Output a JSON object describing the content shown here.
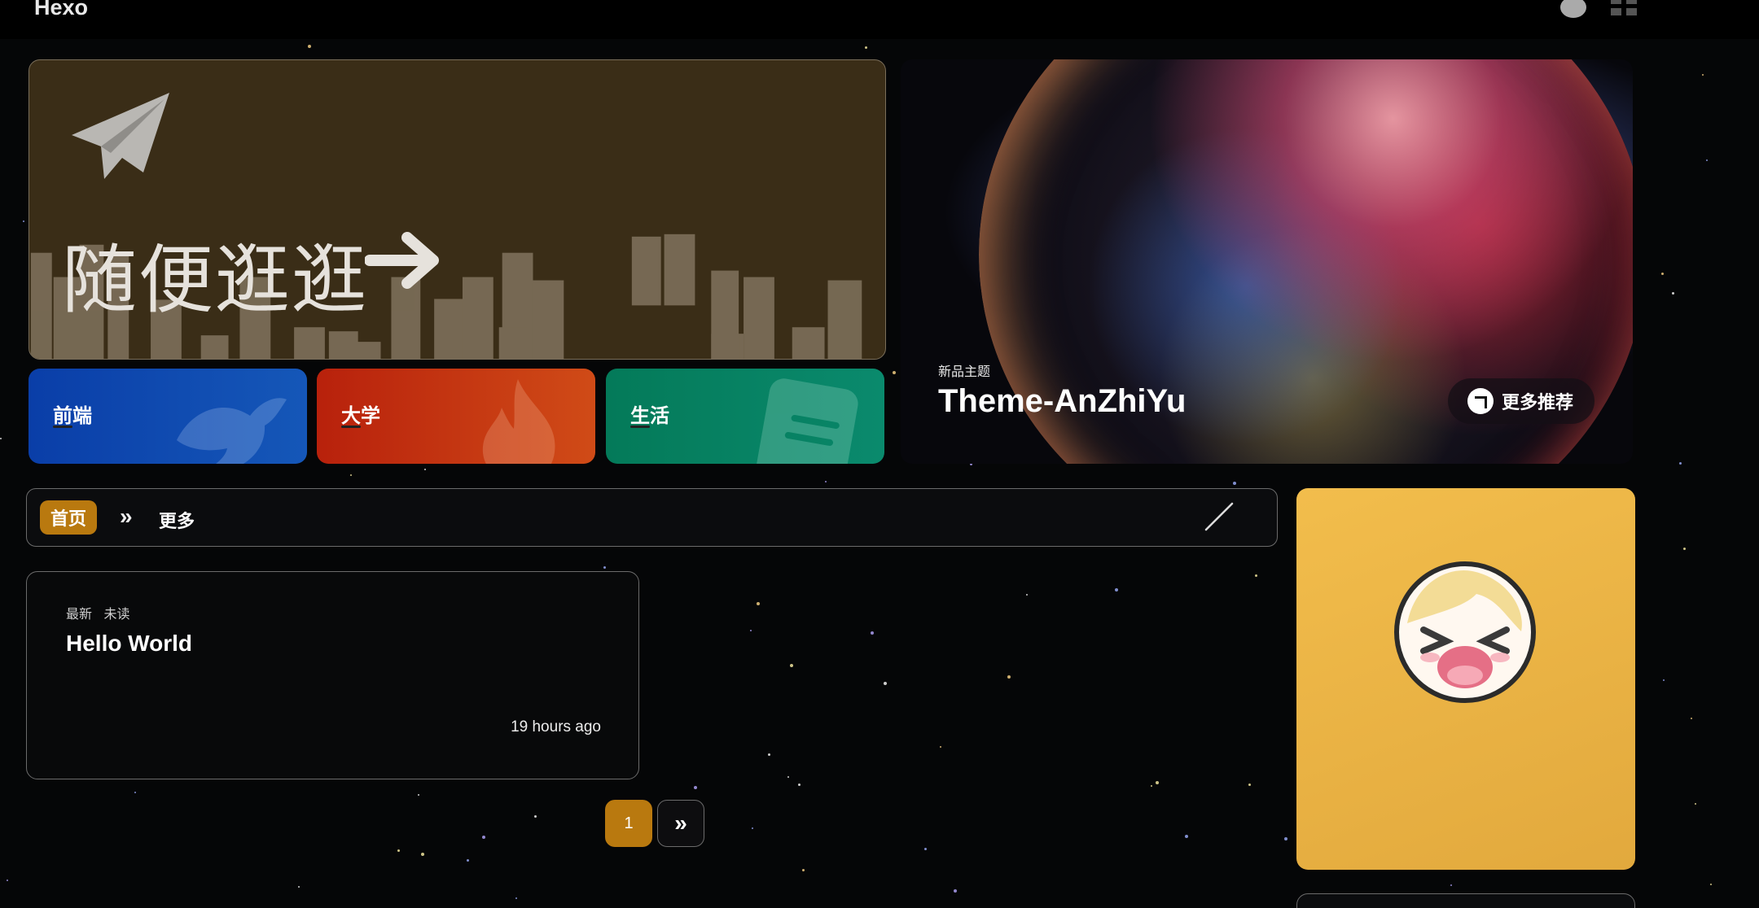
{
  "header": {
    "brand": "Hexo",
    "icons": [
      "wechat-icon",
      "grid-menu-icon"
    ]
  },
  "random": {
    "title": "随便逛逛",
    "icons": [
      "paper-plane-icon",
      "arrow-right-icon"
    ],
    "background": "#3a2d17"
  },
  "categories": [
    {
      "label": "前端",
      "icon": "bird-icon",
      "color": "#0a3ea8"
    },
    {
      "label": "大学",
      "icon": "flame-icon",
      "color": "#c0320f"
    },
    {
      "label": "生活",
      "icon": "document-icon",
      "color": "#047a59"
    }
  ],
  "feature": {
    "tag": "新品主题",
    "title": "Theme-AnZhiYu",
    "more_label": "更多推荐"
  },
  "breadcrumb": {
    "home": "首页",
    "separator": "»",
    "more": "更多"
  },
  "post": {
    "meta": [
      "最新",
      "未读"
    ],
    "title": "Hello World",
    "time": "19 hours ago"
  },
  "pagination": {
    "current": "1",
    "next": "»"
  },
  "colors": {
    "accent": "#b9790f",
    "sidebar_card": "#f2bd4c",
    "background": "#050607"
  }
}
